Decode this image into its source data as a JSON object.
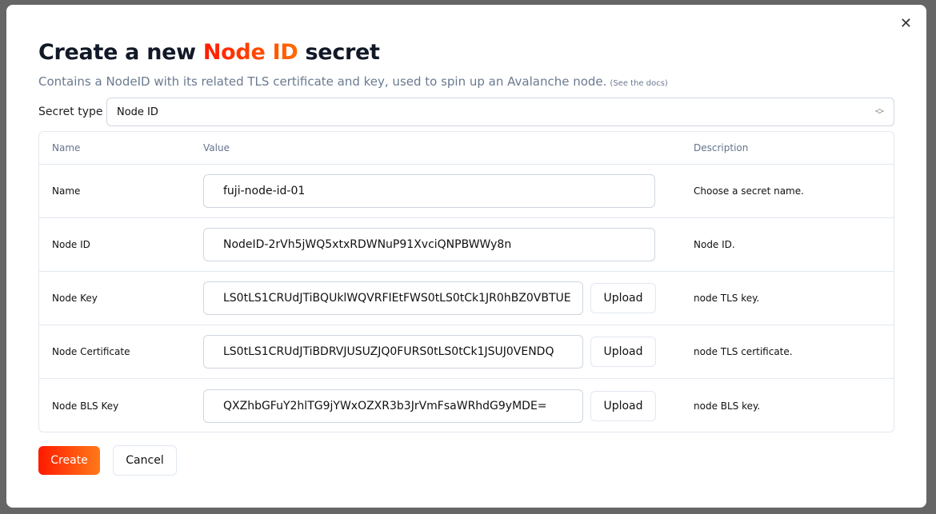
{
  "dialog": {
    "close_icon": "close-icon",
    "title_pre": "Create a new ",
    "title_accent": "Node ID",
    "title_post": " secret",
    "subtitle": "Contains a NodeID with its related TLS certificate and key, used to spin up an Avalanche node.",
    "docs_link": "(See the docs)"
  },
  "secret_type": {
    "label": "Secret type",
    "value": "Node ID"
  },
  "table": {
    "headers": [
      "Name",
      "Value",
      "Description"
    ],
    "rows": [
      {
        "name": "Name",
        "value": "fuji-node-id-01",
        "description": "Choose a secret name."
      },
      {
        "name": "Node ID",
        "value": "NodeID-2rVh5jWQ5xtxRDWNuP91XvciQNPBWWy8n",
        "description": "Node ID."
      },
      {
        "name": "Node Key",
        "value": "LS0tLS1CRUdJTiBQUklWQVRFIEtFWS0tLS0tCk1JR0hBZ0VBTUE",
        "description": "node TLS key.",
        "upload": "Upload"
      },
      {
        "name": "Node Certificate",
        "value": "LS0tLS1CRUdJTiBDRVJUSUZJQ0FURS0tLS0tCk1JSUJ0VENDQ",
        "description": "node TLS certificate.",
        "upload": "Upload"
      },
      {
        "name": "Node BLS Key",
        "value": "QXZhbGFuY2hlTG9jYWxOZXR3b3JrVmFsaWRhdG9yMDE=",
        "description": "node BLS key.",
        "upload": "Upload"
      }
    ]
  },
  "actions": {
    "create": "Create",
    "cancel": "Cancel"
  },
  "colors": {
    "accent_start": "#ff1a00",
    "accent_end": "#ff7a1a"
  }
}
